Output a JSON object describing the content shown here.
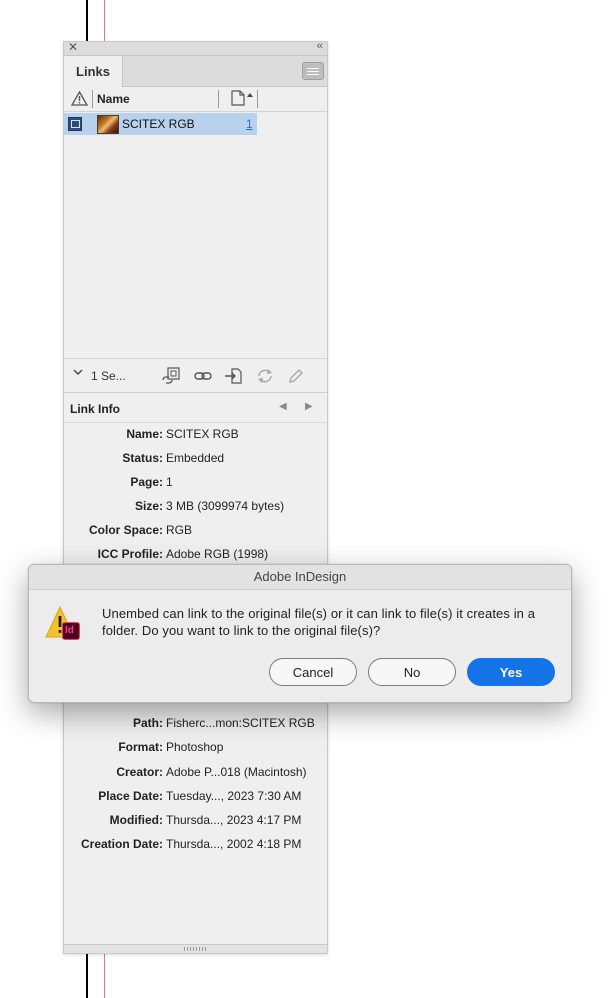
{
  "panel": {
    "close_glyph": "✕",
    "collapse_glyph": "‹‹",
    "tab_label": "Links",
    "columns": {
      "name": "Name"
    },
    "rows": [
      {
        "name": "SCITEX RGB",
        "page": "1"
      }
    ],
    "toolbar": {
      "selection_status": "1 Se...",
      "buttons": [
        "relink-from-cc-icon",
        "relink-icon",
        "goto-link-icon",
        "update-link-icon",
        "edit-original-icon"
      ]
    },
    "link_info": {
      "title": "Link Info",
      "fields": [
        {
          "label": "Name:",
          "value": "SCITEX RGB"
        },
        {
          "label": "Status:",
          "value": "Embedded"
        },
        {
          "label": "Page:",
          "value": "1"
        },
        {
          "label": "Size:",
          "value": "3 MB (3099974 bytes)"
        },
        {
          "label": "Color Space:",
          "value": "RGB"
        },
        {
          "label": "ICC Profile:",
          "value": "Adobe RGB (1998)"
        },
        {
          "label": "Path:",
          "value": "Fisherc...mon:SCITEX RGB"
        },
        {
          "label": "Format:",
          "value": "Photoshop"
        },
        {
          "label": "Creator:",
          "value": "Adobe P...018 (Macintosh)"
        },
        {
          "label": "Place Date:",
          "value": "Tuesday..., 2023 7:30 AM"
        },
        {
          "label": "Modified:",
          "value": "Thursda..., 2023 4:17 PM"
        },
        {
          "label": "Creation Date:",
          "value": "Thursda..., 2002 4:18 PM"
        }
      ]
    }
  },
  "dialog": {
    "title": "Adobe InDesign",
    "app_badge": "Id",
    "message": "Unembed can link to the original file(s) or it can link to file(s) it creates in a folder. Do you want to link to the original file(s)?",
    "buttons": {
      "cancel": "Cancel",
      "no": "No",
      "yes": "Yes"
    }
  },
  "colors": {
    "accent": "#1473e6",
    "selection": "#b8d1ec",
    "warning": "#f2c12e",
    "indesign_badge": "#49021f"
  }
}
